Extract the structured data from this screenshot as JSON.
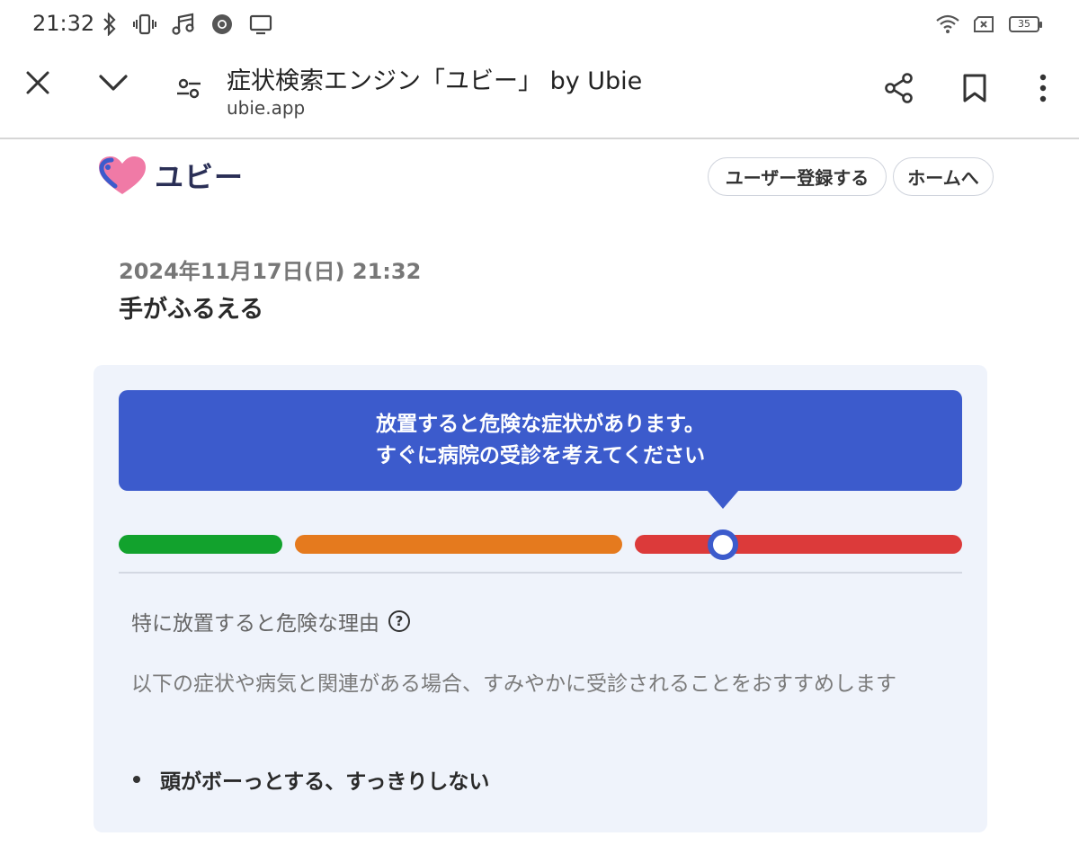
{
  "status_bar": {
    "time": "21:32",
    "left_icons": [
      "bluetooth-icon",
      "vibrate-icon",
      "music-icon",
      "chrome-icon",
      "cast-icon"
    ],
    "right_icons": [
      "wifi-icon",
      "no-sim-icon",
      "battery-icon"
    ],
    "battery_level": "35"
  },
  "browser": {
    "title": "症状検索エンジン「ユビー」 by Ubie",
    "url": "ubie.app"
  },
  "header": {
    "logo_text": "ユビー",
    "register_button": "ユーザー登録する",
    "home_button": "ホームへ"
  },
  "result": {
    "date": "2024年11月17日(日) 21:32",
    "symptom": "手がふるえる",
    "banner_line1": "放置すると危険な症状があります。",
    "banner_line2": "すぐに病院の受診を考えてください",
    "severity_level": "high",
    "reason_title": "特に放置すると危険な理由",
    "help_symbol": "?",
    "description": "以下の症状や病気と関連がある場合、すみやかに受診されることをおすすめします",
    "items": [
      "頭がボーっとする、すっきりしない"
    ]
  },
  "colors": {
    "accent": "#3c5bcc",
    "green": "#12a22d",
    "orange": "#e57a1e",
    "red": "#dc3a3a",
    "card_bg": "#eff3fb"
  }
}
